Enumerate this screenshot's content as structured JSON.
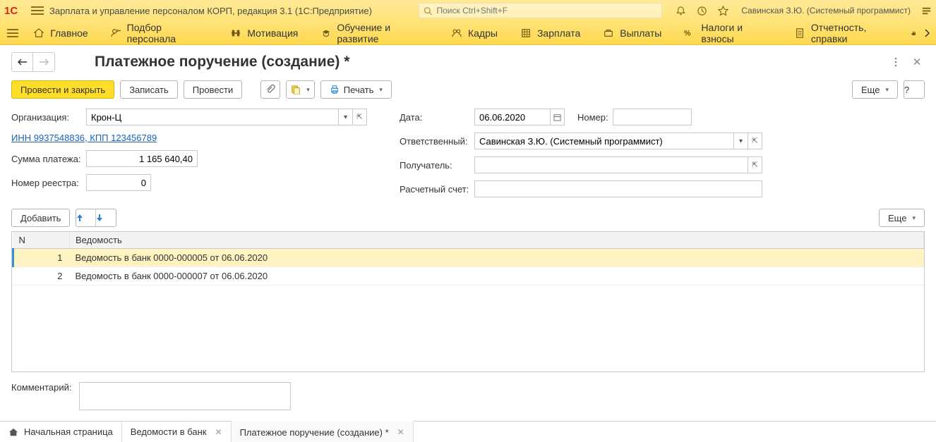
{
  "titlebar": {
    "title": "Зарплата и управление персоналом КОРП, редакция 3.1  (1C:Предприятие)",
    "search_placeholder": "Поиск Ctrl+Shift+F",
    "user": "Савинская З.Ю. (Системный программист)"
  },
  "nav": {
    "items": [
      {
        "label": "Главное"
      },
      {
        "label": "Подбор персонала"
      },
      {
        "label": "Мотивация"
      },
      {
        "label": "Обучение и развитие"
      },
      {
        "label": "Кадры"
      },
      {
        "label": "Зарплата"
      },
      {
        "label": "Выплаты"
      },
      {
        "label": "Налоги и взносы"
      },
      {
        "label": "Отчетность, справки"
      }
    ]
  },
  "page": {
    "title": "Платежное поручение (создание) *"
  },
  "toolbar": {
    "post_close": "Провести и закрыть",
    "save": "Записать",
    "post": "Провести",
    "print": "Печать",
    "more": "Еще",
    "help": "?"
  },
  "form": {
    "org_label": "Организация:",
    "org_value": "Крон-Ц",
    "inn_link": "ИНН 9937548836, КПП 123456789",
    "sum_label": "Сумма платежа:",
    "sum_value": "1 165 640,40",
    "reg_label": "Номер реестра:",
    "reg_value": "0",
    "date_label": "Дата:",
    "date_value": "06.06.2020",
    "number_label": "Номер:",
    "number_value": "",
    "resp_label": "Ответственный:",
    "resp_value": "Савинская З.Ю. (Системный программист)",
    "payee_label": "Получатель:",
    "payee_value": "",
    "account_label": "Расчетный счет:",
    "account_value": ""
  },
  "tbl_toolbar": {
    "add": "Добавить",
    "more": "Еще"
  },
  "table": {
    "cols": {
      "n": "N",
      "ved": "Ведомость"
    },
    "rows": [
      {
        "n": "1",
        "ved": "Ведомость в банк 0000-000005 от 06.06.2020",
        "selected": true
      },
      {
        "n": "2",
        "ved": "Ведомость в банк 0000-000007 от 06.06.2020",
        "selected": false
      }
    ]
  },
  "comment": {
    "label": "Комментарий:",
    "value": ""
  },
  "tabs": [
    {
      "label": "Начальная страница",
      "home": true,
      "closable": false,
      "active": false
    },
    {
      "label": "Ведомости в банк",
      "closable": true,
      "active": false
    },
    {
      "label": "Платежное поручение (создание) *",
      "closable": true,
      "active": true
    }
  ]
}
